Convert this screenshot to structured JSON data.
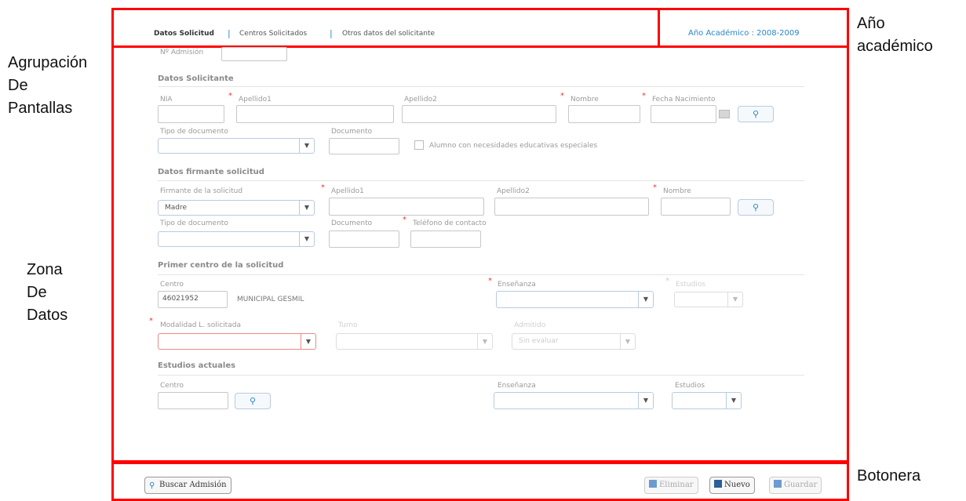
{
  "annotations": {
    "agrupacion": "Agrupación De Pantallas",
    "agrupacion_lines": [
      "Agrupación",
      "De",
      "Pantallas"
    ],
    "anio_lines": [
      "Año",
      "académico"
    ],
    "zona_lines": [
      "Zona",
      "De",
      "Datos"
    ],
    "botonera": "Botonera"
  },
  "tabs": {
    "items": [
      "Datos Solicitud",
      "Centros Solicitados",
      "Otros datos del solicitante"
    ],
    "separator": "|"
  },
  "academic_year": "Año Académico : 2008-2009",
  "form": {
    "admision_label": "Nº Admisión",
    "datos_solicitante": {
      "title": "Datos Solicitante",
      "nia": "NIA",
      "apellido1": "Apellido1",
      "apellido2": "Apellido2",
      "nombre": "Nombre",
      "fecha_nacimiento": "Fecha Nacimiento",
      "tipo_documento": "Tipo de documento",
      "documento": "Documento",
      "necesidades": "Alumno con necesidades educativas especiales"
    },
    "datos_firmante": {
      "title": "Datos firmante solicitud",
      "firmante": "Firmante de la solicitud",
      "firmante_value": "Madre",
      "apellido1": "Apellido1",
      "apellido2": "Apellido2",
      "nombre": "Nombre",
      "tipo_documento": "Tipo de documento",
      "documento": "Documento",
      "telefono": "Teléfono de contacto"
    },
    "primer_centro": {
      "title": "Primer centro de la solicitud",
      "centro": "Centro",
      "centro_code": "46021952",
      "centro_name": "MUNICIPAL GESMIL",
      "ensenanza": "Enseñanza",
      "estudios": "Estudios",
      "modalidad": "Modalidad L. solicitada",
      "turno": "Turno",
      "admitido": "Admitido",
      "admitido_value": "Sin evaluar"
    },
    "estudios_actuales": {
      "title": "Estudios actuales",
      "centro": "Centro",
      "ensenanza": "Enseñanza",
      "estudios": "Estudios"
    },
    "asterisk": "*",
    "select_arrow": "▼"
  },
  "buttons": {
    "buscar": "Buscar Admisión",
    "eliminar": "Eliminar",
    "nuevo": "Nuevo",
    "guardar": "Guardar"
  },
  "colors": {
    "annotation_border": "#ff0000",
    "accent": "#2a86c8",
    "required": "#e43a3a"
  }
}
